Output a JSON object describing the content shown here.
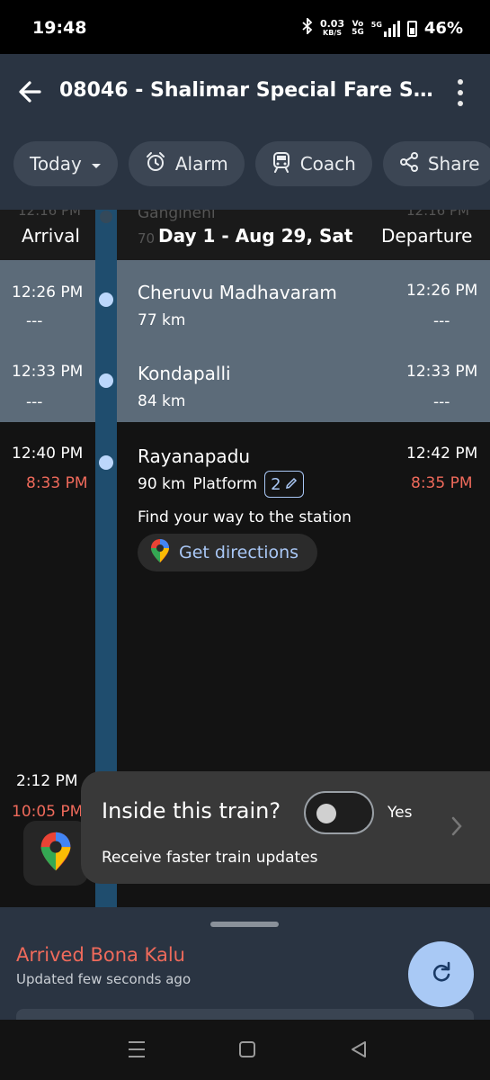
{
  "status_bar": {
    "time": "19:48",
    "net_speed": "0.03",
    "net_unit": "KB/S",
    "vo_label": "Vo",
    "vo_sub": "5G",
    "network": "5G",
    "battery": "46%"
  },
  "app_bar": {
    "title": "08046 - Shalimar Special Fare Speci...",
    "back_icon": "arrow-left-icon",
    "menu_icon": "kebab-menu-icon"
  },
  "chips": [
    {
      "label": "Today",
      "icon": "chevron-down-icon"
    },
    {
      "label": "Alarm",
      "icon": "alarm-clock-icon"
    },
    {
      "label": "Coach",
      "icon": "train-icon"
    },
    {
      "label": "Share",
      "icon": "share-icon"
    }
  ],
  "header": {
    "arrival": "Arrival",
    "day": "Day 1 - Aug 29, Sat",
    "departure": "Departure",
    "ghost_name": "Gangineni",
    "ghost_km": "70",
    "ghost_time_left": "12:16 PM",
    "ghost_time_right": "12:16 PM"
  },
  "stations": [
    {
      "name": "Cheruvu Madhavaram",
      "km": "77 km",
      "arr": "12:26 PM",
      "arr_status": "---",
      "dep": "12:26 PM",
      "dep_status": "---"
    },
    {
      "name": "Kondapalli",
      "km": "84 km",
      "arr": "12:33 PM",
      "arr_status": "---",
      "dep": "12:33 PM",
      "dep_status": "---"
    },
    {
      "name": "Rayanapadu",
      "km": "90 km",
      "platform_label": "Platform",
      "platform": "2",
      "arr": "12:40 PM",
      "arr_status": "8:33 PM",
      "dep": "12:42 PM",
      "dep_status": "8:35 PM",
      "find_text": "Find your way to the station",
      "directions_label": "Get directions"
    },
    {
      "arr": "2:12 PM",
      "arr_status": "10:05 PM"
    }
  ],
  "inside_train": {
    "title": "Inside this train?",
    "toggle_label": "Yes",
    "subtitle": "Receive faster train updates",
    "toggle_on": false
  },
  "bottom_sheet": {
    "status": "Arrived Bona Kalu",
    "updated": "Updated few seconds ago"
  },
  "colors": {
    "accent_blue": "#a9c9f5",
    "late_red": "#ef6a5b",
    "app_bar": "#2a3442",
    "rail": "#1f4d6e"
  }
}
